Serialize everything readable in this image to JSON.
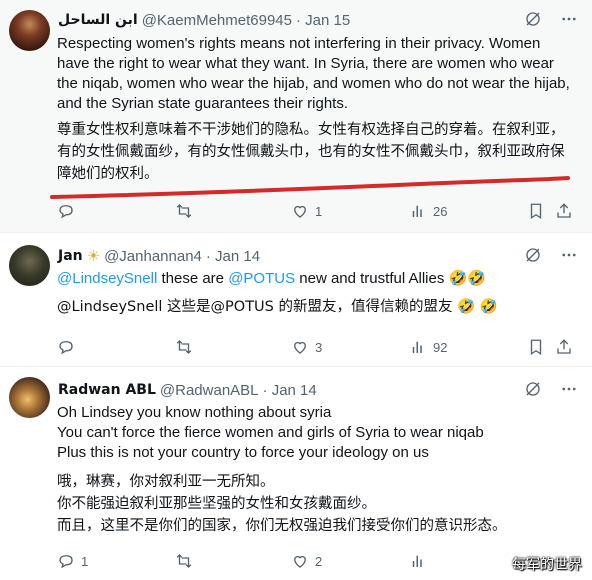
{
  "tweets": [
    {
      "name": "ابن الساحل",
      "handle": "@KaemMehmet69945",
      "date": "· Jan 15",
      "text_en": "Respecting women's rights means not interfering in their privacy. Women have the right to wear what they want. In Syria, there are women who wear the niqab, women who wear the hijab, and women who do not wear the hijab, and the Syrian state guarantees their rights.",
      "text_zh": "尊重女性权利意味着不干涉她们的隐私。女性有权选择自己的穿着。在叙利亚，有的女性佩戴面纱，有的女性佩戴头巾，也有的女性不佩戴头巾，叙利亚政府保障她们的权利。",
      "stats": {
        "replies": "",
        "reposts": "",
        "likes": "1",
        "views": "26"
      }
    },
    {
      "name": "Jan",
      "handle": "@Janhannan4",
      "date": "· Jan 14",
      "mention1": "@LindseySnell",
      "text_mid1": " these are ",
      "mention2": "@POTUS",
      "text_end1": " new and trustful Allies 🤣🤣",
      "text_zh": "@LindseySnell 这些是@POTUS 的新盟友，值得信赖的盟友 🤣 🤣",
      "stats": {
        "replies": "",
        "reposts": "",
        "likes": "3",
        "views": "92"
      }
    },
    {
      "name": "Radwan ABL",
      "handle": "@RadwanABL",
      "date": "· Jan 14",
      "line1": "Oh Lindsey you know nothing about syria",
      "line2": "You can't force the fierce women and girls of Syria to wear niqab",
      "line3": "Plus this is not your country to force your ideology on us",
      "zh1": "哦，琳赛，你对叙利亚一无所知。",
      "zh2": "你不能强迫叙利亚那些坚强的女性和女孩戴面纱。",
      "zh3": "而且，这里不是你们的国家，你们无权强迫我们接受你们的意识形态。",
      "stats": {
        "replies": "1",
        "reposts": "",
        "likes": "2",
        "views": ""
      }
    }
  ],
  "watermark": "每军的世界"
}
